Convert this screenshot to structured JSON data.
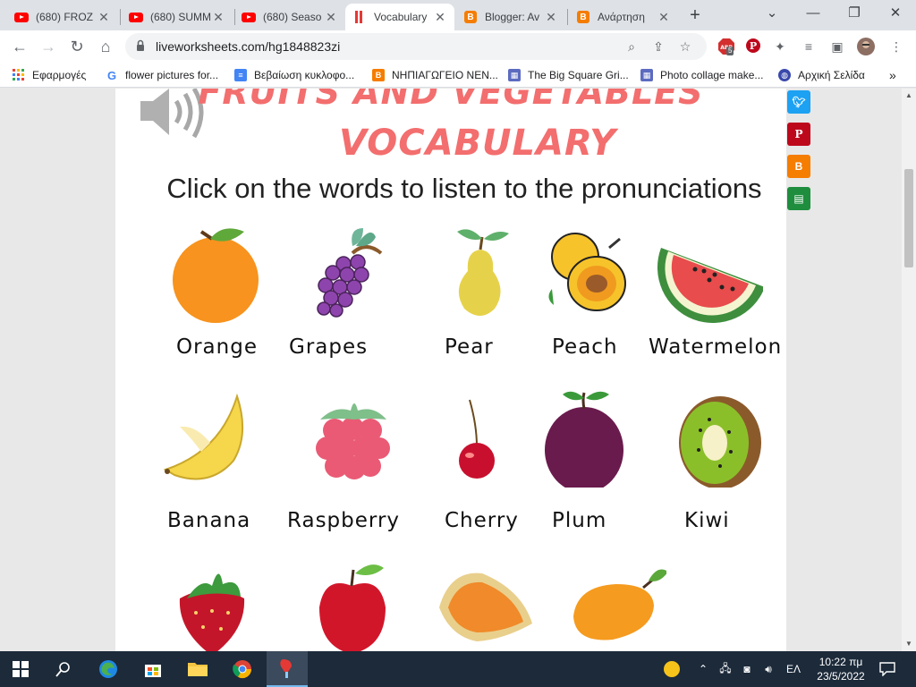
{
  "browser": {
    "tabs": [
      {
        "title": "(680) FROZ",
        "icon": "youtube-icon"
      },
      {
        "title": "(680) SUMM",
        "icon": "youtube-icon"
      },
      {
        "title": "(680) Seaso",
        "icon": "youtube-icon"
      },
      {
        "title": "Vocabulary",
        "icon": "liveworksheets-icon"
      },
      {
        "title": "Blogger: Av",
        "icon": "blogger-icon"
      },
      {
        "title": "Ανάρτηση",
        "icon": "blogger-icon"
      }
    ],
    "url": "liveworksheets.com/hg1848823zi",
    "extension_badge": "5",
    "bookmarks": [
      {
        "label": "Εφαρμογές",
        "icon": "apps-grid-icon"
      },
      {
        "label": "flower pictures for...",
        "icon": "google-icon"
      },
      {
        "label": "Βεβαίωση κυκλοφο...",
        "icon": "docs-icon"
      },
      {
        "label": "ΝΗΠΙΑΓΩΓΕΙΟ ΝΕΝ...",
        "icon": "blogger-icon"
      },
      {
        "label": "The Big Square Gri...",
        "icon": "image-icon"
      },
      {
        "label": "Photo collage make...",
        "icon": "image-icon"
      },
      {
        "label": "Αρχική Σελίδα",
        "icon": "globe-icon"
      }
    ],
    "overflow_label": "»"
  },
  "worksheet": {
    "title_line1": "FRUITS AND VEGETABLES",
    "title_line2": "VOCABULARY",
    "instruction": "Click on the words to listen to the pronunciations",
    "words": [
      "Orange",
      "Grapes",
      "Pear",
      "Peach",
      "Watermelon",
      "Banana",
      "Raspberry",
      "Cherry",
      "Plum",
      "Kiwi"
    ]
  },
  "taskbar": {
    "language": "ΕΛ",
    "time": "10:22 πμ",
    "date": "23/5/2022"
  },
  "colors": {
    "title": "#f36e6e",
    "twitter": "#1da1f2",
    "pinterest": "#bd081c",
    "blogger": "#f57d00",
    "classroom": "#1e8e3e"
  }
}
